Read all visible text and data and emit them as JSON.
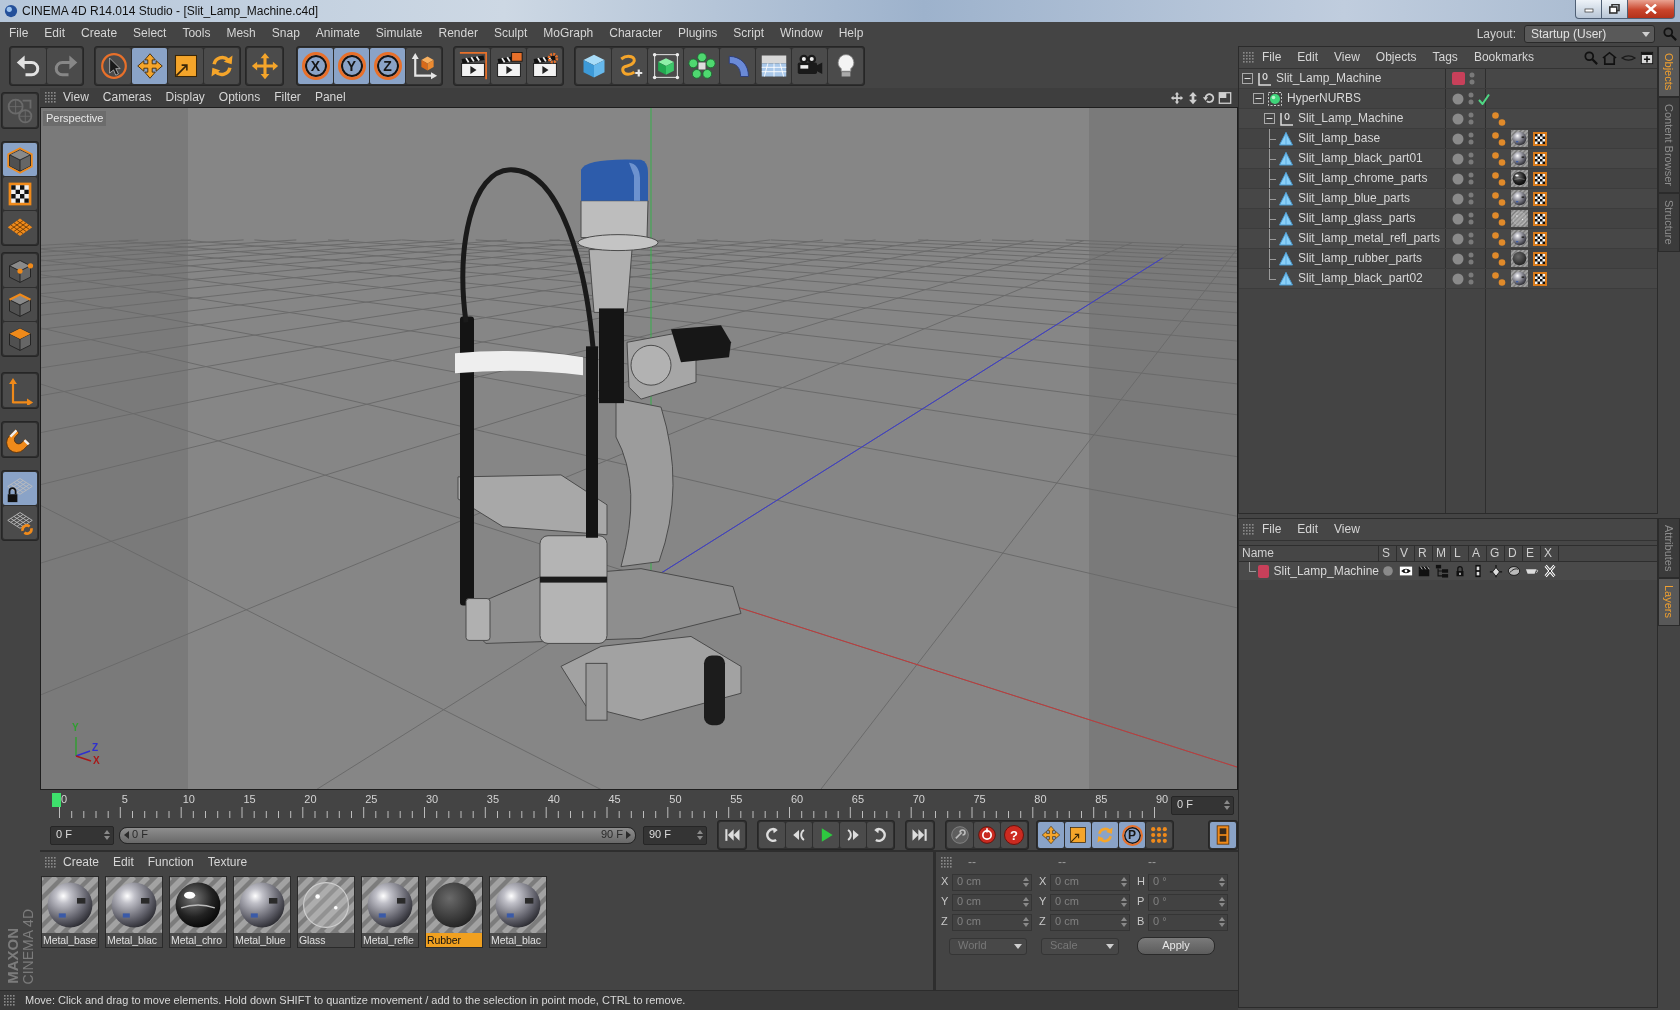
{
  "window": {
    "title": "CINEMA 4D R14.014 Studio - [Slit_Lamp_Machine.c4d]"
  },
  "menu_bar": [
    "File",
    "Edit",
    "Create",
    "Select",
    "Tools",
    "Mesh",
    "Snap",
    "Animate",
    "Simulate",
    "Render",
    "Sculpt",
    "MoGraph",
    "Character",
    "Plugins",
    "Script",
    "Window",
    "Help"
  ],
  "layout": {
    "label": "Layout:",
    "value": "Startup (User)"
  },
  "toolbar": [
    [
      {
        "selected": false,
        "disabled": false
      },
      {
        "selected": false,
        "disabled": true
      }
    ],
    [
      {
        "selected": false
      },
      {
        "selected": true
      },
      {
        "selected": false
      },
      {
        "selected": false
      }
    ],
    [
      {
        "selected": false
      }
    ],
    [
      {
        "label": "X",
        "selected": true
      },
      {
        "label": "Y",
        "selected": true
      },
      {
        "label": "Z",
        "selected": true
      },
      {
        "selected": false
      }
    ],
    [
      {
        "selected": false
      },
      {
        "selected": false
      },
      {
        "selected": false
      }
    ],
    [
      {
        "selected": false
      },
      {
        "selected": false
      },
      {
        "selected": false
      },
      {
        "selected": false
      },
      {
        "selected": false
      },
      {
        "selected": false
      },
      {
        "selected": false
      },
      {
        "selected": false
      }
    ]
  ],
  "mode_toolbar": [
    [
      {
        "selected": false,
        "disabled": true
      }
    ],
    [
      {
        "selected": true
      },
      {
        "selected": false
      },
      {
        "selected": false
      }
    ],
    [
      {
        "selected": false
      },
      {
        "selected": false
      },
      {
        "selected": false
      }
    ],
    [
      {
        "selected": false
      }
    ],
    [
      {
        "selected": false
      }
    ],
    [
      {
        "selected": true
      },
      {
        "selected": false
      }
    ]
  ],
  "logo": {
    "brand": "MAXON",
    "product": "CINEMA 4D"
  },
  "viewport": {
    "menu": [
      "View",
      "Cameras",
      "Display",
      "Options",
      "Filter",
      "Panel"
    ],
    "camera": "Perspective",
    "axes": [
      {
        "label": "Y",
        "color": "#2f9f2f"
      },
      {
        "label": "Z",
        "color": "#2f2fcf"
      },
      {
        "label": "X",
        "color": "#a81818"
      }
    ]
  },
  "timeline": {
    "ticks": [
      "0",
      "5",
      "10",
      "15",
      "20",
      "25",
      "30",
      "35",
      "40",
      "45",
      "50",
      "55",
      "60",
      "65",
      "70",
      "75",
      "80",
      "85",
      "90"
    ],
    "playhead": {
      "level": 0
    },
    "current_frame": "0 F"
  },
  "playback": {
    "start_frame": "0 F",
    "range": {
      "start": "0 F",
      "end": "90 F",
      "level": 1
    },
    "end_frame": "90 F",
    "buttons": [
      [
        {
          "selected": false
        }
      ],
      [
        {
          "selected": false
        },
        {
          "selected": false
        },
        {
          "selected": false
        },
        {
          "selected": false
        },
        {
          "selected": false
        }
      ],
      [
        {
          "selected": false
        }
      ],
      [
        {
          "selected": false
        },
        {
          "selected": false
        },
        {
          "label": "?",
          "selected": false
        }
      ],
      [
        {
          "selected": true
        },
        {
          "selected": true
        },
        {
          "selected": true
        },
        {
          "label": "P",
          "selected": true
        },
        {
          "selected": false
        }
      ],
      [
        {
          "selected": true
        }
      ]
    ]
  },
  "material_manager": {
    "menu": [
      "Create",
      "Edit",
      "Function",
      "Texture"
    ],
    "materials": [
      {
        "name": "Metal_base",
        "kind": "metal",
        "selected": false
      },
      {
        "name": "Metal_blac",
        "kind": "metal",
        "selected": false
      },
      {
        "name": "Metal_chro",
        "kind": "chrome",
        "selected": false
      },
      {
        "name": "Metal_blue",
        "kind": "metal",
        "selected": false
      },
      {
        "name": "Glass",
        "kind": "glass",
        "selected": false
      },
      {
        "name": "Metal_refle",
        "kind": "metal",
        "selected": false
      },
      {
        "name": "Rubber",
        "kind": "rubber",
        "selected": true
      },
      {
        "name": "Metal_blac",
        "kind": "metal",
        "selected": false
      }
    ]
  },
  "coordinates": {
    "headers": [
      "--",
      "--",
      "--"
    ],
    "disabled": true,
    "rows": [
      {
        "cells": [
          {
            "label": "X",
            "value": "0 cm"
          },
          {
            "label": "X",
            "value": "0 cm"
          },
          {
            "label": "H",
            "value": "0 °"
          }
        ]
      },
      {
        "cells": [
          {
            "label": "Y",
            "value": "0 cm"
          },
          {
            "label": "Y",
            "value": "0 cm"
          },
          {
            "label": "P",
            "value": "0 °"
          }
        ]
      },
      {
        "cells": [
          {
            "label": "Z",
            "value": "0 cm"
          },
          {
            "label": "Z",
            "value": "0 cm"
          },
          {
            "label": "B",
            "value": "0 °"
          }
        ]
      }
    ],
    "mode": "World",
    "transform": "Scale",
    "apply": "Apply"
  },
  "status_bar": "Move: Click and drag to move elements. Hold down SHIFT to quantize movement / add to the selection in point mode, CTRL to remove.",
  "object_manager": {
    "menu": [
      "File",
      "Edit",
      "View",
      "Objects",
      "Tags",
      "Bookmarks"
    ],
    "objects": [
      {
        "name": "Slit_Lamp_Machine",
        "kind": "null",
        "color": "#c8405a",
        "expanded": true,
        "selected": false,
        "children": [
          {
            "name": "HyperNURBS",
            "kind": "hypernurbs",
            "enabled": true,
            "expanded": true,
            "selected": false,
            "children": [
              {
                "name": "Slit_Lamp_Machine",
                "kind": "null",
                "expanded": true,
                "selected": false,
                "tags": [
                  {
                    "kind": "phong"
                  }
                ],
                "children": [
                  {
                    "name": "Slit_lamp_base",
                    "kind": "polygon",
                    "selected": false,
                    "tags": [
                      {
                        "kind": "phong"
                      },
                      {
                        "kind": "metal"
                      },
                      {
                        "kind": "uvw"
                      }
                    ]
                  },
                  {
                    "name": "Slit_lamp_black_part01",
                    "kind": "polygon",
                    "selected": false,
                    "tags": [
                      {
                        "kind": "phong"
                      },
                      {
                        "kind": "metal"
                      },
                      {
                        "kind": "uvw"
                      }
                    ]
                  },
                  {
                    "name": "Slit_lamp_chrome_parts",
                    "kind": "polygon",
                    "selected": false,
                    "tags": [
                      {
                        "kind": "phong"
                      },
                      {
                        "kind": "chrome"
                      },
                      {
                        "kind": "uvw"
                      }
                    ]
                  },
                  {
                    "name": "Slit_lamp_blue_parts",
                    "kind": "polygon",
                    "selected": false,
                    "tags": [
                      {
                        "kind": "phong"
                      },
                      {
                        "kind": "metal"
                      },
                      {
                        "kind": "uvw"
                      }
                    ]
                  },
                  {
                    "name": "Slit_lamp_glass_parts",
                    "kind": "polygon",
                    "selected": false,
                    "tags": [
                      {
                        "kind": "phong"
                      },
                      {
                        "kind": "glass"
                      },
                      {
                        "kind": "uvw"
                      }
                    ]
                  },
                  {
                    "name": "Slit_lamp_metal_refl_parts",
                    "kind": "polygon",
                    "selected": false,
                    "tags": [
                      {
                        "kind": "phong"
                      },
                      {
                        "kind": "metal"
                      },
                      {
                        "kind": "uvw"
                      }
                    ]
                  },
                  {
                    "name": "Slit_lamp_rubber_parts",
                    "kind": "polygon",
                    "selected": false,
                    "tags": [
                      {
                        "kind": "phong"
                      },
                      {
                        "kind": "rubber"
                      },
                      {
                        "kind": "uvw"
                      }
                    ]
                  },
                  {
                    "name": "Slit_lamp_black_part02",
                    "kind": "polygon",
                    "selected": false,
                    "tags": [
                      {
                        "kind": "phong"
                      },
                      {
                        "kind": "metal"
                      },
                      {
                        "kind": "uvw"
                      }
                    ]
                  }
                ]
              }
            ]
          }
        ]
      }
    ]
  },
  "side_tabs_top": [
    {
      "label": "Objects",
      "selected": true
    },
    {
      "label": "Content Browser",
      "selected": false
    },
    {
      "label": "Structure",
      "selected": false
    }
  ],
  "layer_manager": {
    "menu": [
      "File",
      "Edit",
      "View"
    ],
    "columns": [
      "Name",
      "S",
      "V",
      "R",
      "M",
      "L",
      "A",
      "G",
      "D",
      "E",
      "X"
    ],
    "layers": [
      {
        "name": "Slit_Lamp_Machine",
        "color": "#c8405a"
      }
    ]
  },
  "side_tabs_bottom": [
    {
      "label": "Attributes",
      "selected": false
    },
    {
      "label": "Layers",
      "selected": true
    }
  ]
}
